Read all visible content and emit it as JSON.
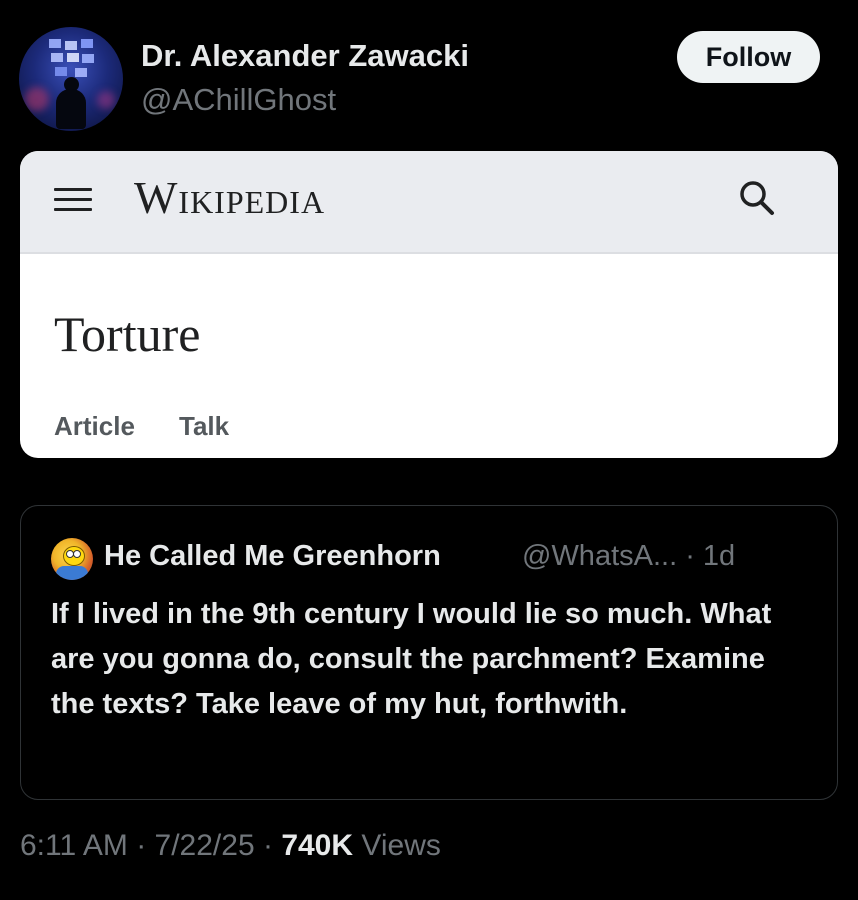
{
  "author": {
    "display_name": "Dr. Alexander Zawacki",
    "handle": "@AChillGhost"
  },
  "follow_label": "Follow",
  "wikipedia_card": {
    "logo_text": "Wikipedia",
    "article_title": "Torture",
    "tabs": [
      "Article",
      "Talk"
    ]
  },
  "quoted_post": {
    "author_name": "He Called Me Greenhorn",
    "meta": "@WhatsA... · 1d",
    "text": "If I lived in the 9th century I would lie so much. What are you gonna do, consult the parchment? Examine the texts? Take leave of my hut, forthwith."
  },
  "post_meta": {
    "time": "6:11 AM",
    "separator": "·",
    "date": "7/22/25",
    "views_count": "740K",
    "views_label": "Views"
  },
  "colors": {
    "background": "#000000",
    "primary_text": "#e7e9ea",
    "secondary_text": "#71767b",
    "follow_button_bg": "#eff3f4",
    "wiki_header_bg": "#eaecf0"
  },
  "icons": [
    "hamburger-menu-icon",
    "search-icon"
  ]
}
